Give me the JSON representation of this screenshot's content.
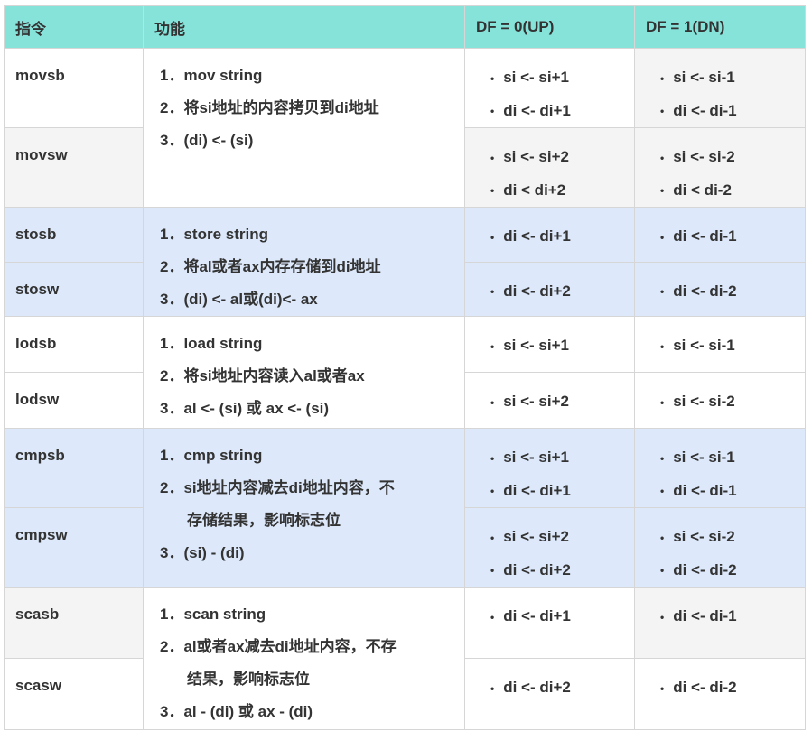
{
  "header": {
    "col1": "指令",
    "col2": "功能",
    "col3": "DF = 0(UP)",
    "col4": "DF = 1(DN)"
  },
  "groups": [
    {
      "func": [
        "1．mov string",
        "2．将si地址的内容拷贝到di地址",
        "3．(di) <- (si)"
      ],
      "rows": [
        {
          "instr": "movsb",
          "up": [
            "si <- si+1",
            "di <- di+1"
          ],
          "dn": [
            "si <- si-1",
            "di <- di-1"
          ]
        },
        {
          "instr": "movsw",
          "up": [
            "si <- si+2",
            "di < di+2"
          ],
          "dn": [
            "si <- si-2",
            "di < di-2"
          ]
        }
      ]
    },
    {
      "func": [
        "1．store string",
        "2．将al或者ax内存存储到di地址",
        "3．(di) <- al或(di)<- ax"
      ],
      "rows": [
        {
          "instr": "stosb",
          "up": [
            "di <- di+1"
          ],
          "dn": [
            "di <- di-1"
          ]
        },
        {
          "instr": "stosw",
          "up": [
            "di <- di+2"
          ],
          "dn": [
            "di <- di-2"
          ]
        }
      ]
    },
    {
      "func": [
        "1．load string",
        "2．将si地址内容读入al或者ax",
        "3．al <- (si) 或 ax <- (si)"
      ],
      "rows": [
        {
          "instr": "lodsb",
          "up": [
            "si <- si+1"
          ],
          "dn": [
            "si <- si-1"
          ]
        },
        {
          "instr": "lodsw",
          "up": [
            "si <- si+2"
          ],
          "dn": [
            "si <- si-2"
          ]
        }
      ]
    },
    {
      "func": [
        "1．cmp string",
        "2．si地址内容减去di地址内容，不",
        "存储结果，影响标志位",
        "3．(si) - (di)"
      ],
      "rows": [
        {
          "instr": "cmpsb",
          "up": [
            "si <- si+1",
            "di <- di+1"
          ],
          "dn": [
            "si <- si-1",
            "di <- di-1"
          ]
        },
        {
          "instr": "cmpsw",
          "up": [
            "si <- si+2",
            "di <- di+2"
          ],
          "dn": [
            "si <- si-2",
            "di <- di-2"
          ]
        }
      ]
    },
    {
      "func": [
        "1．scan string",
        "2．al或者ax减去di地址内容，不存",
        "结果，影响标志位",
        "3．al - (di) 或 ax - (di)"
      ],
      "rows": [
        {
          "instr": "scasb",
          "up": [
            "di <- di+1"
          ],
          "dn": [
            "di <- di-1"
          ]
        },
        {
          "instr": "scasw",
          "up": [
            "di <- di+2"
          ],
          "dn": [
            "di <- di-2"
          ]
        }
      ]
    }
  ]
}
